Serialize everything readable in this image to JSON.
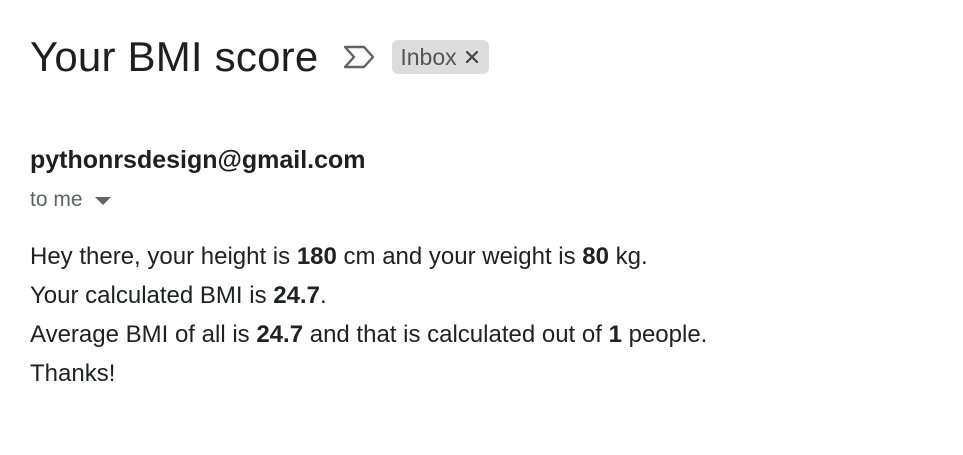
{
  "email": {
    "subject": "Your BMI score",
    "label_chip": "Inbox",
    "sender": "pythonrsdesign@gmail.com",
    "recipient": "to me",
    "body": {
      "line1": {
        "t1": "Hey there, your height is ",
        "height": "180",
        "t2": " cm and your weight is ",
        "weight": "80",
        "t3": " kg."
      },
      "line2": {
        "t1": "Your calculated BMI is ",
        "bmi": "24.7",
        "t2": "."
      },
      "line3": {
        "t1": "Average BMI of all is ",
        "avg_bmi": "24.7",
        "t2": " and that is calculated out of ",
        "count": "1",
        "t3": " people."
      },
      "line4": "Thanks!"
    }
  },
  "icons": {
    "important": "important-marker-icon",
    "chip_close": "close-icon",
    "recipient_caret": "chevron-down-icon"
  },
  "colors": {
    "text": "#202124",
    "muted": "#5f6368",
    "chip_bg": "#dddddd"
  }
}
